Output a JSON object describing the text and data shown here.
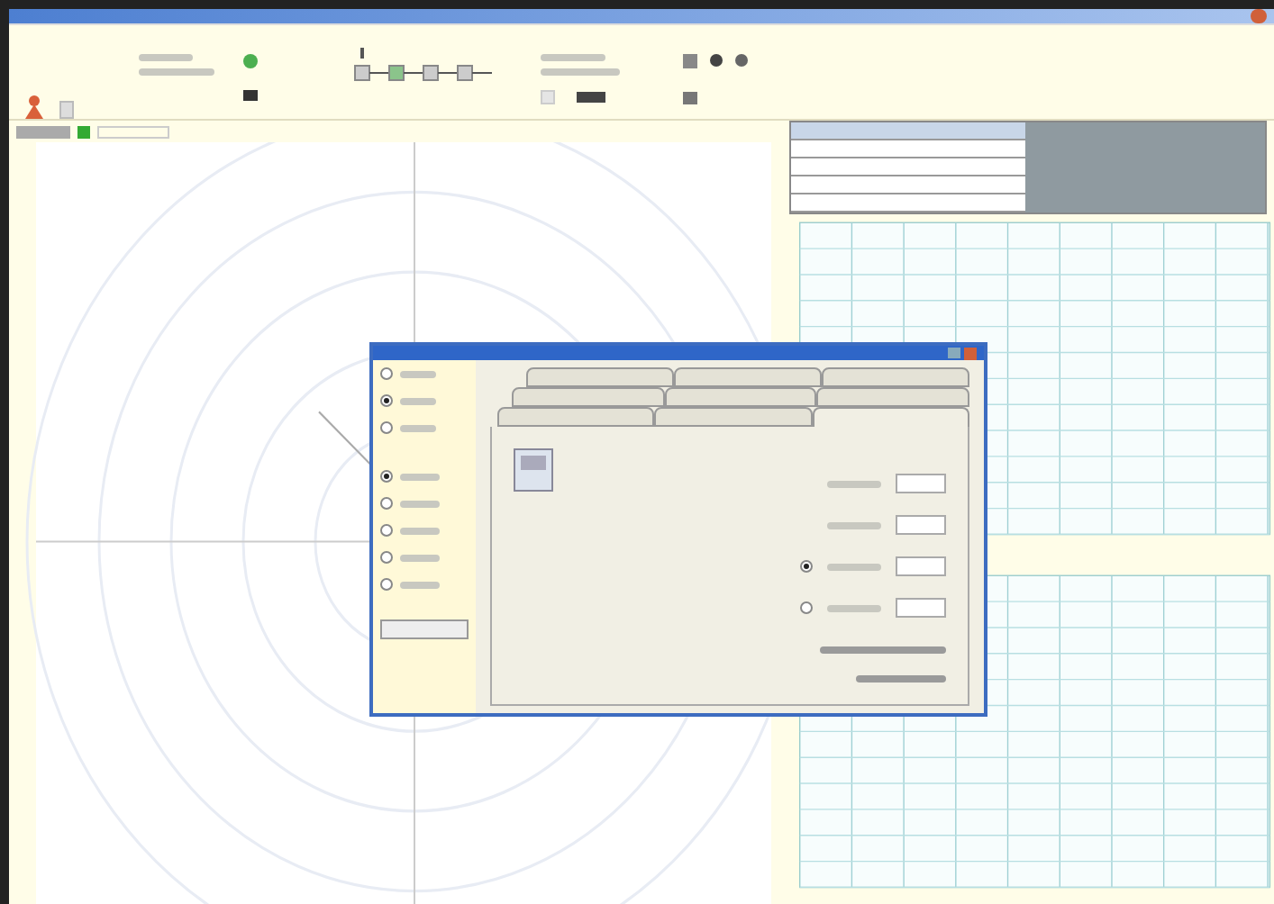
{
  "toolbar": {
    "groups": [
      {
        "kind": "alert"
      },
      {
        "kind": "signal"
      },
      {
        "kind": "chain"
      },
      {
        "kind": "playback"
      },
      {
        "kind": "display"
      }
    ]
  },
  "table": {
    "rows": [
      {
        "selected": true
      },
      {
        "selected": false
      },
      {
        "selected": false
      },
      {
        "selected": false
      },
      {
        "selected": false
      }
    ]
  },
  "dialog": {
    "mode_options": [
      {
        "selected": false
      },
      {
        "selected": true
      },
      {
        "selected": false
      }
    ],
    "type_options": [
      {
        "selected": true
      },
      {
        "selected": false
      },
      {
        "selected": false
      },
      {
        "selected": false
      },
      {
        "selected": false
      }
    ],
    "tab_rows": [
      [
        {
          "selected": false
        },
        {
          "selected": false
        },
        {
          "selected": false
        }
      ],
      [
        {
          "selected": false
        },
        {
          "selected": false
        },
        {
          "selected": false
        }
      ],
      [
        {
          "selected": false
        },
        {
          "selected": false
        },
        {
          "selected": true
        }
      ]
    ],
    "fields": [
      {
        "kind": "plain"
      },
      {
        "kind": "plain"
      },
      {
        "kind": "radio",
        "selected": true
      },
      {
        "kind": "radio",
        "selected": false
      }
    ]
  }
}
